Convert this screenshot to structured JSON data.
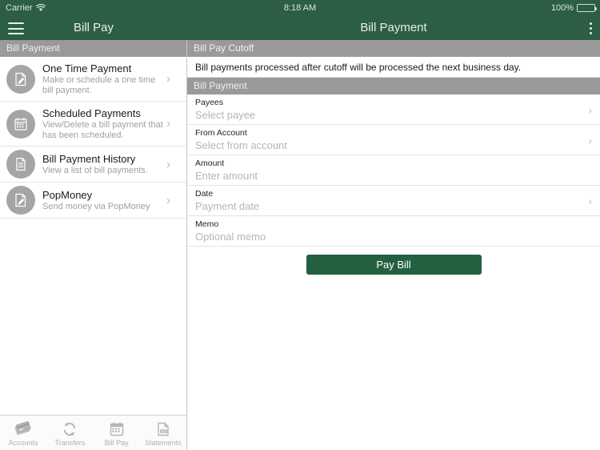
{
  "status_bar": {
    "carrier": "Carrier",
    "wifi_icon": "wifi-icon",
    "time": "8:18 AM",
    "battery_percent": "100%",
    "battery_icon": "battery-icon"
  },
  "colors": {
    "brand_green": "#2c5e45",
    "button_green": "#22603f",
    "section_header_gray": "#9a9a9a",
    "icon_circle_gray": "#a5a5a5",
    "placeholder_gray": "#b5b5b5"
  },
  "left_pane": {
    "nav": {
      "menu_icon": "hamburger-icon",
      "title": "Bill Pay"
    },
    "section_header": "Bill Payment",
    "items": [
      {
        "title": "One Time Payment",
        "subtitle": "Make or schedule a one time bill payment.",
        "icon": "document-pencil-icon"
      },
      {
        "title": "Scheduled Payments",
        "subtitle": "View/Delete a bill payment that has been scheduled.",
        "icon": "calendar-icon"
      },
      {
        "title": "Bill Payment History",
        "subtitle": "View a list of bill payments.",
        "icon": "document-lines-icon"
      },
      {
        "title": "PopMoney",
        "subtitle": "Send money via PopMoney",
        "icon": "document-pencil-icon"
      }
    ],
    "chevron": "›"
  },
  "tab_bar": {
    "tabs": [
      {
        "label": "Accounts",
        "icon": "credit-cards-icon"
      },
      {
        "label": "Transfers",
        "icon": "refresh-arrows-icon"
      },
      {
        "label": "Bill Pay",
        "icon": "calendar-icon"
      },
      {
        "label": "Statements",
        "icon": "pdf-document-icon"
      }
    ]
  },
  "right_pane": {
    "nav": {
      "title": "Bill Payment",
      "overflow_icon": "overflow-menu-icon"
    },
    "cutoff_section_header": "Bill Pay Cutoff",
    "cutoff_note": "Bill payments processed after cutoff will be processed the next business day.",
    "form_section_header": "Bill Payment",
    "fields": [
      {
        "label": "Payees",
        "placeholder": "Select payee",
        "has_chevron": true
      },
      {
        "label": "From Account",
        "placeholder": "Select from account",
        "has_chevron": true
      },
      {
        "label": "Amount",
        "placeholder": "Enter amount",
        "has_chevron": false
      },
      {
        "label": "Date",
        "placeholder": "Payment date",
        "has_chevron": true
      },
      {
        "label": "Memo",
        "placeholder": "Optional memo",
        "has_chevron": false
      }
    ],
    "chevron": "›",
    "submit_button": "Pay Bill"
  }
}
